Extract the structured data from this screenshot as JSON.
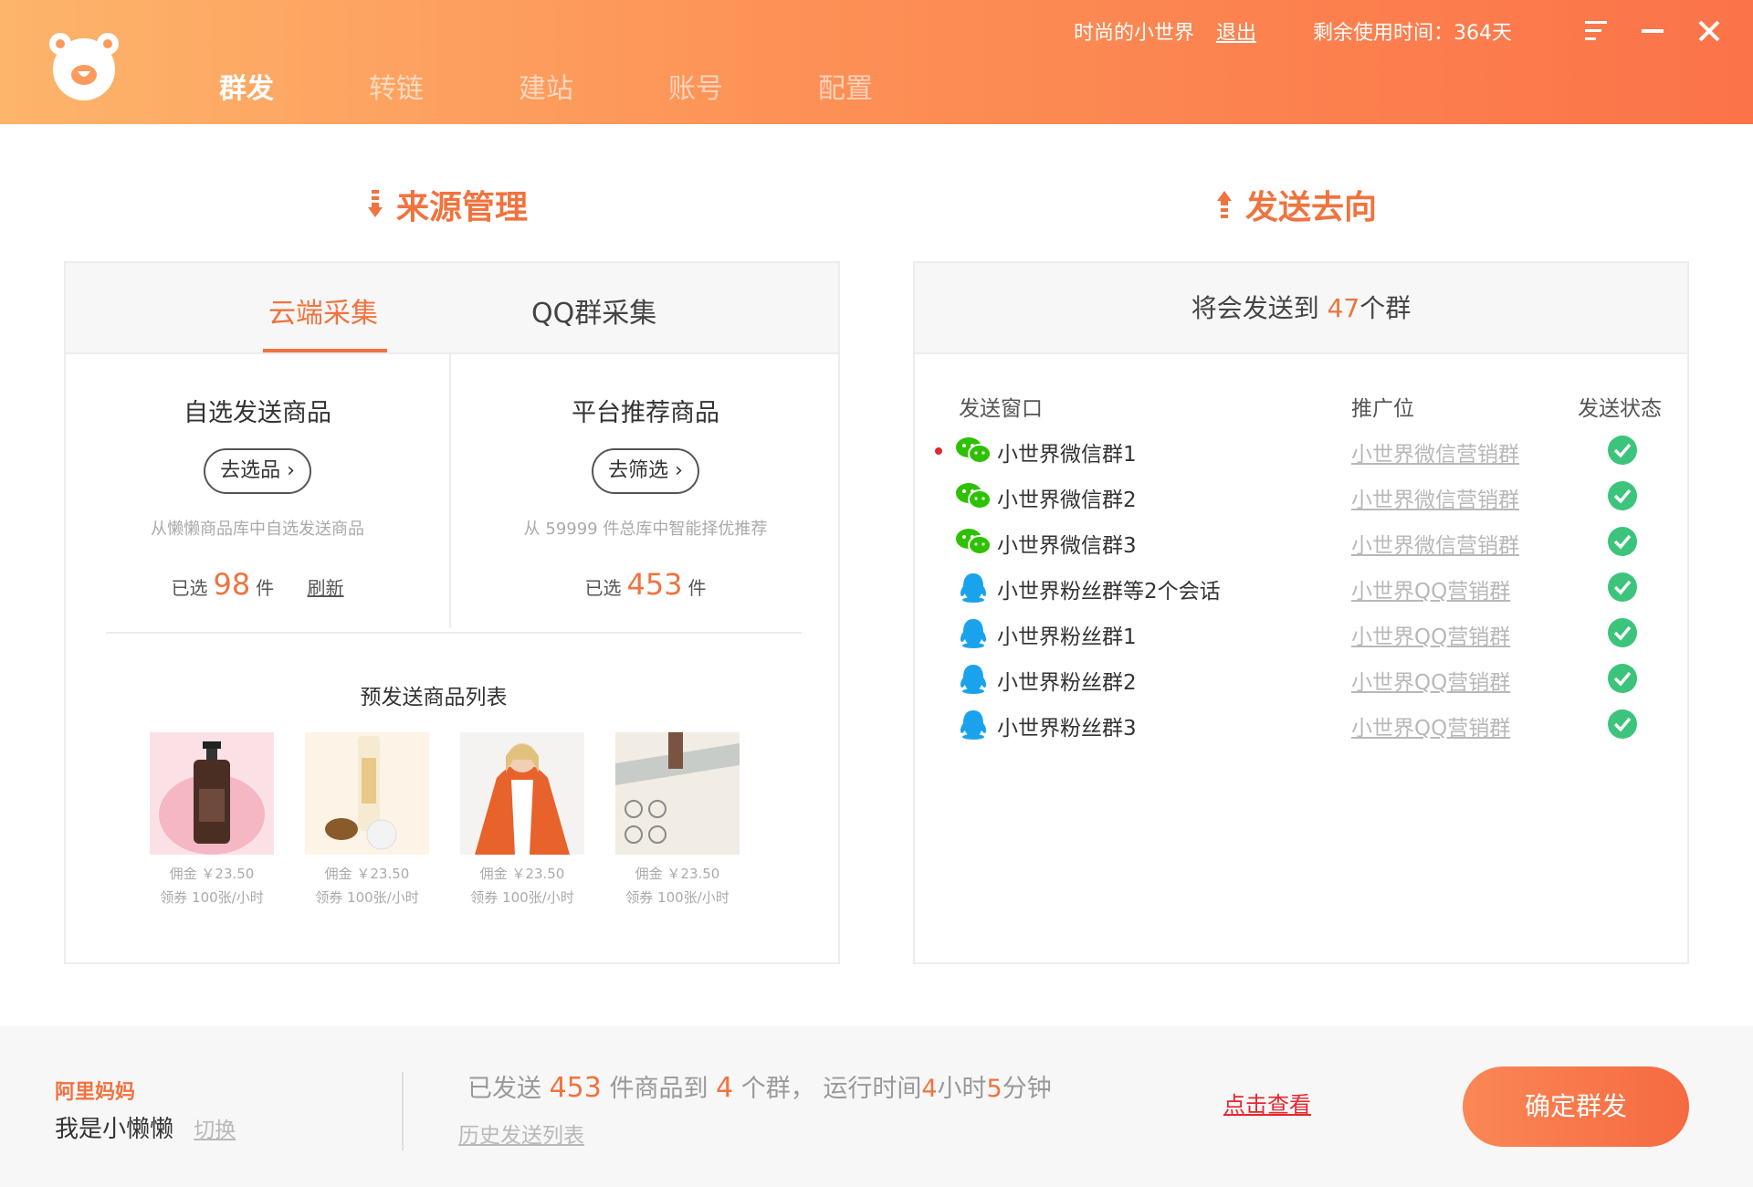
{
  "header": {
    "nav": [
      "群发",
      "转链",
      "建站",
      "账号",
      "配置"
    ],
    "user_name": "时尚的小世界",
    "logout": "退出",
    "remaining": "剩余使用时间：364天"
  },
  "source": {
    "title": "来源管理",
    "tabs": [
      "云端采集",
      "QQ群采集"
    ],
    "manual": {
      "title": "自选发送商品",
      "button": "去选品",
      "desc": "从懒懒商品库中自选发送商品",
      "selected_prefix": "已选",
      "selected_count": "98",
      "selected_unit": "件",
      "refresh": "刷新"
    },
    "platform": {
      "title": "平台推荐商品",
      "button": "去筛选",
      "desc": "从 59999 件总库中智能择优推荐",
      "selected_prefix": "已选",
      "selected_count": "453",
      "selected_unit": "件"
    },
    "preview_title": "预发送商品列表",
    "products": [
      {
        "commission": "佣金 ￥23.50",
        "coupon": "领券 100张/小时"
      },
      {
        "commission": "佣金 ￥23.50",
        "coupon": "领券 100张/小时"
      },
      {
        "commission": "佣金 ￥23.50",
        "coupon": "领券 100张/小时"
      },
      {
        "commission": "佣金 ￥23.50",
        "coupon": "领券 100张/小时"
      }
    ]
  },
  "target": {
    "title": "发送去向",
    "summary_prefix": "将会发送到",
    "summary_count": "47",
    "summary_suffix": "个群",
    "columns": [
      "发送窗口",
      "推广位",
      "发送状态"
    ],
    "rows": [
      {
        "icon": "wechat-icon",
        "name": "小世界微信群1",
        "promo": "小世界微信营销群",
        "active": true
      },
      {
        "icon": "wechat-icon",
        "name": "小世界微信群2",
        "promo": "小世界微信营销群"
      },
      {
        "icon": "wechat-icon",
        "name": "小世界微信群3",
        "promo": "小世界微信营销群"
      },
      {
        "icon": "qq-icon",
        "name": "小世界粉丝群等2个会话",
        "promo": "小世界QQ营销群"
      },
      {
        "icon": "qq-icon",
        "name": "小世界粉丝群1",
        "promo": "小世界QQ营销群"
      },
      {
        "icon": "qq-icon",
        "name": "小世界粉丝群2",
        "promo": "小世界QQ营销群"
      },
      {
        "icon": "qq-icon",
        "name": "小世界粉丝群3",
        "promo": "小世界QQ营销群"
      }
    ]
  },
  "footer": {
    "brand": "阿里妈妈",
    "user": "我是小懒懒",
    "switch": "切换",
    "stat_sent": "已发送",
    "stat_items": "453",
    "stat_items_to": "件商品到",
    "stat_groups": "4",
    "stat_groups_unit": "个群，",
    "stat_runtime": "运行时间",
    "stat_hours": "4",
    "stat_hours_unit": "小时",
    "stat_minutes": "5",
    "stat_minutes_unit": "分钟",
    "history": "历史发送列表",
    "view": "点击查看",
    "confirm": "确定群发"
  },
  "colors": {
    "accent": "#f0733f",
    "success": "#3cc47c",
    "wechat": "#2dc100",
    "qq": "#1aa3ec"
  }
}
